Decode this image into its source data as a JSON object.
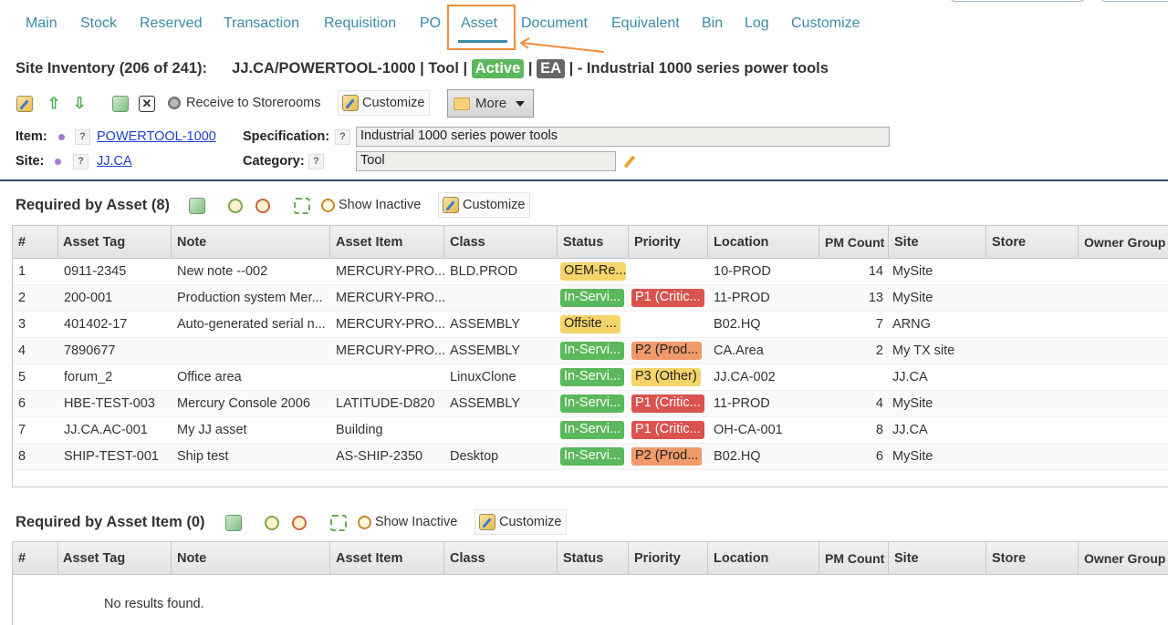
{
  "tabs": [
    "Main",
    "Stock",
    "Reserved",
    "Transaction",
    "Requisition",
    "PO",
    "Asset",
    "Document",
    "Equivalent",
    "Bin",
    "Log",
    "Customize"
  ],
  "active_tab": "Asset",
  "title": {
    "prefix": "Site Inventory (206 of 241):",
    "code": "JJ.CA/POWERTOOL-1000 | Tool |",
    "status": "Active",
    "sep": "|",
    "unit": "EA",
    "desc": "| - Industrial 1000 series power tools"
  },
  "toolbar": {
    "receive": "Receive to Storerooms",
    "customize": "Customize",
    "more": "More"
  },
  "fields": {
    "item_label": "Item:",
    "item_value": "POWERTOOL-1000",
    "site_label": "Site:",
    "site_value": "JJ.CA",
    "spec_label": "Specification:",
    "spec_value": "Industrial 1000 series power tools",
    "cat_label": "Category:",
    "cat_value": "Tool",
    "help": "?"
  },
  "section1": {
    "title": "Required by Asset (8)",
    "show_inactive": "Show Inactive",
    "customize": "Customize",
    "columns": [
      "#",
      "Asset Tag",
      "Note",
      "Asset Item",
      "Class",
      "Status",
      "Priority",
      "Location",
      "PM Count",
      "Site",
      "Store",
      "Owner Group"
    ],
    "rows": [
      {
        "n": "1",
        "tag": "0911-2345",
        "note": "New note --002",
        "item": "MERCURY-PRO...",
        "cls": "BLD.PROD",
        "status": "OEM-Re...",
        "status_c": "yellow",
        "prio": "",
        "prio_c": "",
        "loc": "10-PROD",
        "pm": "14",
        "site": "MySite"
      },
      {
        "n": "2",
        "tag": "200-001",
        "note": "Production system Mer...",
        "item": "MERCURY-PRO...",
        "cls": "",
        "status": "In-Servi...",
        "status_c": "green",
        "prio": "P1 (Critic...",
        "prio_c": "red",
        "loc": "11-PROD",
        "pm": "13",
        "site": "MySite"
      },
      {
        "n": "3",
        "tag": "401402-17",
        "note": "Auto-generated serial n...",
        "item": "MERCURY-PRO...",
        "cls": "ASSEMBLY",
        "status": "Offsite ...",
        "status_c": "yellow",
        "prio": "",
        "prio_c": "",
        "loc": "B02.HQ",
        "pm": "7",
        "site": "ARNG"
      },
      {
        "n": "4",
        "tag": "7890677",
        "note": "",
        "item": "MERCURY-PRO...",
        "cls": "ASSEMBLY",
        "status": "In-Servi...",
        "status_c": "green",
        "prio": "P2 (Prod...",
        "prio_c": "orange",
        "loc": "CA.Area",
        "pm": "2",
        "site": "My TX site"
      },
      {
        "n": "5",
        "tag": "forum_2",
        "note": "Office area",
        "item": "",
        "cls": "LinuxClone",
        "status": "In-Servi...",
        "status_c": "green",
        "prio": "P3 (Other)",
        "prio_c": "yellow",
        "loc": "JJ.CA-002",
        "pm": "",
        "site": "JJ.CA"
      },
      {
        "n": "6",
        "tag": "HBE-TEST-003",
        "note": "Mercury Console 2006",
        "item": "LATITUDE-D820",
        "cls": "ASSEMBLY",
        "status": "In-Servi...",
        "status_c": "green",
        "prio": "P1 (Critic...",
        "prio_c": "red",
        "loc": "11-PROD",
        "pm": "4",
        "site": "MySite"
      },
      {
        "n": "7",
        "tag": "JJ.CA.AC-001",
        "note": "My JJ asset",
        "item": "Building",
        "cls": "",
        "status": "In-Servi...",
        "status_c": "green",
        "prio": "P1 (Critic...",
        "prio_c": "red",
        "loc": "OH-CA-001",
        "pm": "8",
        "site": "JJ.CA"
      },
      {
        "n": "8",
        "tag": "SHIP-TEST-001",
        "note": "Ship test",
        "item": "AS-SHIP-2350",
        "cls": "Desktop",
        "status": "In-Servi...",
        "status_c": "green",
        "prio": "P2 (Prod...",
        "prio_c": "orange",
        "loc": "B02.HQ",
        "pm": "6",
        "site": "MySite"
      }
    ]
  },
  "section2": {
    "title": "Required by Asset Item (0)",
    "show_inactive": "Show Inactive",
    "customize": "Customize",
    "columns": [
      "#",
      "Asset Tag",
      "Note",
      "Asset Item",
      "Class",
      "Status",
      "Priority",
      "Location",
      "PM Count",
      "Site",
      "Store",
      "Owner Group"
    ],
    "empty": "No results found."
  },
  "colors": {
    "tab": "#3c8aa8",
    "highlight": "#f08c3a",
    "status_green": "#5cb85c",
    "status_yellow": "#f5d46a",
    "priority_red": "#d9534f",
    "priority_orange": "#f0996a"
  }
}
